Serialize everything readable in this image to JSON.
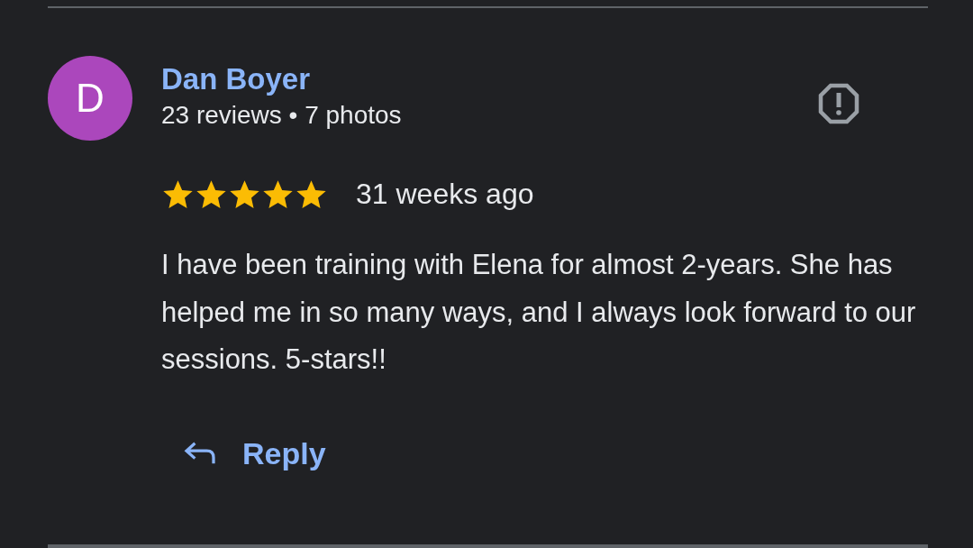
{
  "review": {
    "avatar_letter": "D",
    "author": "Dan Boyer",
    "author_meta": "23 reviews • 7 photos",
    "stars": 5,
    "time": "31 weeks ago",
    "text": "I have been training with Elena for almost 2-years. She has helped me in so many ways, and I always look forward to our sessions. 5-stars!!",
    "reply_label": "Reply"
  }
}
